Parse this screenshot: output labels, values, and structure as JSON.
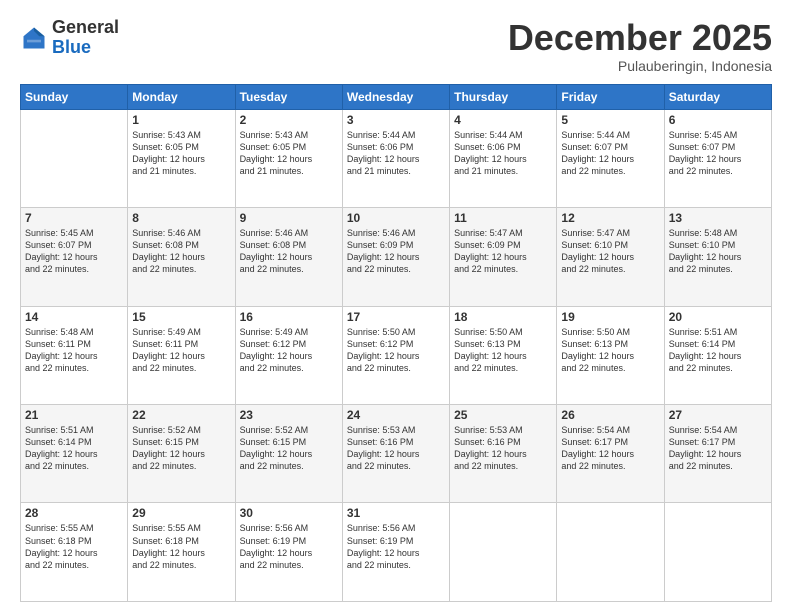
{
  "header": {
    "logo_line1": "General",
    "logo_line2": "Blue",
    "month": "December 2025",
    "location": "Pulauberingin, Indonesia"
  },
  "days_of_week": [
    "Sunday",
    "Monday",
    "Tuesday",
    "Wednesday",
    "Thursday",
    "Friday",
    "Saturday"
  ],
  "weeks": [
    [
      {
        "day": "",
        "info": ""
      },
      {
        "day": "1",
        "info": "Sunrise: 5:43 AM\nSunset: 6:05 PM\nDaylight: 12 hours\nand 21 minutes."
      },
      {
        "day": "2",
        "info": "Sunrise: 5:43 AM\nSunset: 6:05 PM\nDaylight: 12 hours\nand 21 minutes."
      },
      {
        "day": "3",
        "info": "Sunrise: 5:44 AM\nSunset: 6:06 PM\nDaylight: 12 hours\nand 21 minutes."
      },
      {
        "day": "4",
        "info": "Sunrise: 5:44 AM\nSunset: 6:06 PM\nDaylight: 12 hours\nand 21 minutes."
      },
      {
        "day": "5",
        "info": "Sunrise: 5:44 AM\nSunset: 6:07 PM\nDaylight: 12 hours\nand 22 minutes."
      },
      {
        "day": "6",
        "info": "Sunrise: 5:45 AM\nSunset: 6:07 PM\nDaylight: 12 hours\nand 22 minutes."
      }
    ],
    [
      {
        "day": "7",
        "info": "Sunrise: 5:45 AM\nSunset: 6:07 PM\nDaylight: 12 hours\nand 22 minutes."
      },
      {
        "day": "8",
        "info": "Sunrise: 5:46 AM\nSunset: 6:08 PM\nDaylight: 12 hours\nand 22 minutes."
      },
      {
        "day": "9",
        "info": "Sunrise: 5:46 AM\nSunset: 6:08 PM\nDaylight: 12 hours\nand 22 minutes."
      },
      {
        "day": "10",
        "info": "Sunrise: 5:46 AM\nSunset: 6:09 PM\nDaylight: 12 hours\nand 22 minutes."
      },
      {
        "day": "11",
        "info": "Sunrise: 5:47 AM\nSunset: 6:09 PM\nDaylight: 12 hours\nand 22 minutes."
      },
      {
        "day": "12",
        "info": "Sunrise: 5:47 AM\nSunset: 6:10 PM\nDaylight: 12 hours\nand 22 minutes."
      },
      {
        "day": "13",
        "info": "Sunrise: 5:48 AM\nSunset: 6:10 PM\nDaylight: 12 hours\nand 22 minutes."
      }
    ],
    [
      {
        "day": "14",
        "info": "Sunrise: 5:48 AM\nSunset: 6:11 PM\nDaylight: 12 hours\nand 22 minutes."
      },
      {
        "day": "15",
        "info": "Sunrise: 5:49 AM\nSunset: 6:11 PM\nDaylight: 12 hours\nand 22 minutes."
      },
      {
        "day": "16",
        "info": "Sunrise: 5:49 AM\nSunset: 6:12 PM\nDaylight: 12 hours\nand 22 minutes."
      },
      {
        "day": "17",
        "info": "Sunrise: 5:50 AM\nSunset: 6:12 PM\nDaylight: 12 hours\nand 22 minutes."
      },
      {
        "day": "18",
        "info": "Sunrise: 5:50 AM\nSunset: 6:13 PM\nDaylight: 12 hours\nand 22 minutes."
      },
      {
        "day": "19",
        "info": "Sunrise: 5:50 AM\nSunset: 6:13 PM\nDaylight: 12 hours\nand 22 minutes."
      },
      {
        "day": "20",
        "info": "Sunrise: 5:51 AM\nSunset: 6:14 PM\nDaylight: 12 hours\nand 22 minutes."
      }
    ],
    [
      {
        "day": "21",
        "info": "Sunrise: 5:51 AM\nSunset: 6:14 PM\nDaylight: 12 hours\nand 22 minutes."
      },
      {
        "day": "22",
        "info": "Sunrise: 5:52 AM\nSunset: 6:15 PM\nDaylight: 12 hours\nand 22 minutes."
      },
      {
        "day": "23",
        "info": "Sunrise: 5:52 AM\nSunset: 6:15 PM\nDaylight: 12 hours\nand 22 minutes."
      },
      {
        "day": "24",
        "info": "Sunrise: 5:53 AM\nSunset: 6:16 PM\nDaylight: 12 hours\nand 22 minutes."
      },
      {
        "day": "25",
        "info": "Sunrise: 5:53 AM\nSunset: 6:16 PM\nDaylight: 12 hours\nand 22 minutes."
      },
      {
        "day": "26",
        "info": "Sunrise: 5:54 AM\nSunset: 6:17 PM\nDaylight: 12 hours\nand 22 minutes."
      },
      {
        "day": "27",
        "info": "Sunrise: 5:54 AM\nSunset: 6:17 PM\nDaylight: 12 hours\nand 22 minutes."
      }
    ],
    [
      {
        "day": "28",
        "info": "Sunrise: 5:55 AM\nSunset: 6:18 PM\nDaylight: 12 hours\nand 22 minutes."
      },
      {
        "day": "29",
        "info": "Sunrise: 5:55 AM\nSunset: 6:18 PM\nDaylight: 12 hours\nand 22 minutes."
      },
      {
        "day": "30",
        "info": "Sunrise: 5:56 AM\nSunset: 6:19 PM\nDaylight: 12 hours\nand 22 minutes."
      },
      {
        "day": "31",
        "info": "Sunrise: 5:56 AM\nSunset: 6:19 PM\nDaylight: 12 hours\nand 22 minutes."
      },
      {
        "day": "",
        "info": ""
      },
      {
        "day": "",
        "info": ""
      },
      {
        "day": "",
        "info": ""
      }
    ]
  ]
}
